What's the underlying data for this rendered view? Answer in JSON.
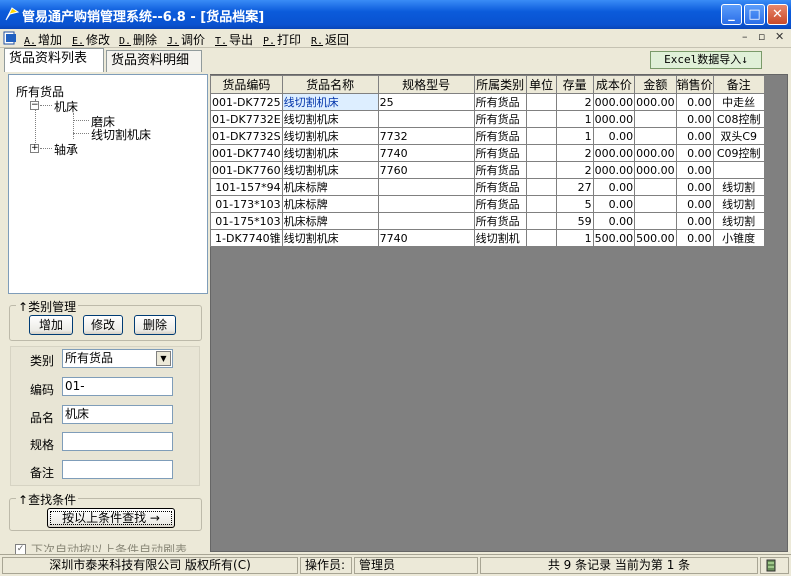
{
  "window": {
    "title": "管易通产购销管理系统--6.8 - [货品档案]"
  },
  "menu": [
    {
      "key": "A.",
      "label": "增加"
    },
    {
      "key": "E.",
      "label": "修改"
    },
    {
      "key": "D.",
      "label": "删除"
    },
    {
      "key": "J.",
      "label": "调价"
    },
    {
      "key": "T.",
      "label": "导出"
    },
    {
      "key": "P.",
      "label": "打印"
    },
    {
      "key": "R.",
      "label": "返回"
    }
  ],
  "tabs": [
    {
      "label": "货品资料列表"
    },
    {
      "label": "货品资料明细"
    }
  ],
  "excel_button": "Excel数据导入↓",
  "tree": {
    "root": "所有货品",
    "n1": "机床",
    "n1a": "磨床",
    "n1b": "线切割机床",
    "n2": "轴承"
  },
  "category_mgmt": {
    "legend": "类别管理",
    "add": "增加",
    "edit": "修改",
    "delete": "删除"
  },
  "form": {
    "category_label": "类别",
    "category_value": "所有货品",
    "code_label": "编码",
    "code_value": "01-",
    "name_label": "品名",
    "name_value": "机床",
    "spec_label": "规格",
    "spec_value": "",
    "note_label": "备注",
    "note_value": ""
  },
  "search": {
    "legend": "查找条件",
    "button": "按以上条件查找 →",
    "auto_label": "下次自动按以上条件自动刷表"
  },
  "grid": {
    "headers": [
      "货品编码",
      "货品名称",
      "规格型号",
      "所属类别",
      "单位",
      "存量",
      "成本价",
      "金额",
      "销售价",
      "备注"
    ],
    "rows": [
      [
        "001-DK7725",
        "线切割机床",
        "25",
        "所有货品",
        "",
        "2",
        "000.00",
        "000.00",
        "0.00",
        "中走丝"
      ],
      [
        "01-DK7732E",
        "线切割机床",
        "",
        "所有货品",
        "",
        "1",
        "000.00",
        "",
        "0.00",
        "C08控制"
      ],
      [
        "01-DK7732S",
        "线切割机床",
        "7732",
        "所有货品",
        "",
        "1",
        "0.00",
        "",
        "0.00",
        "双头C9"
      ],
      [
        "001-DK7740",
        "线切割机床",
        "7740",
        "所有货品",
        "",
        "2",
        "000.00",
        "000.00",
        "0.00",
        "C09控制"
      ],
      [
        "001-DK7760",
        "线切割机床",
        "7760",
        "所有货品",
        "",
        "2",
        "000.00",
        "000.00",
        "0.00",
        ""
      ],
      [
        "101-157*94",
        "机床标牌",
        "",
        "所有货品",
        "",
        "27",
        "0.00",
        "",
        "0.00",
        "线切割"
      ],
      [
        "01-173*103",
        "机床标牌",
        "",
        "所有货品",
        "",
        "5",
        "0.00",
        "",
        "0.00",
        "线切割"
      ],
      [
        "01-175*103",
        "机床标牌",
        "",
        "所有货品",
        "",
        "59",
        "0.00",
        "",
        "0.00",
        "线切割"
      ],
      [
        "1-DK7740锥",
        "线切割机床",
        "7740",
        "线切割机",
        "",
        "1",
        "500.00",
        "500.00",
        "0.00",
        "小锥度"
      ]
    ]
  },
  "status": {
    "company": "深圳市泰来科技有限公司 版权所有(C)",
    "operator_label": "操作员:",
    "operator": "管理员",
    "records": "共 9 条记录 当前为第 1 条"
  }
}
